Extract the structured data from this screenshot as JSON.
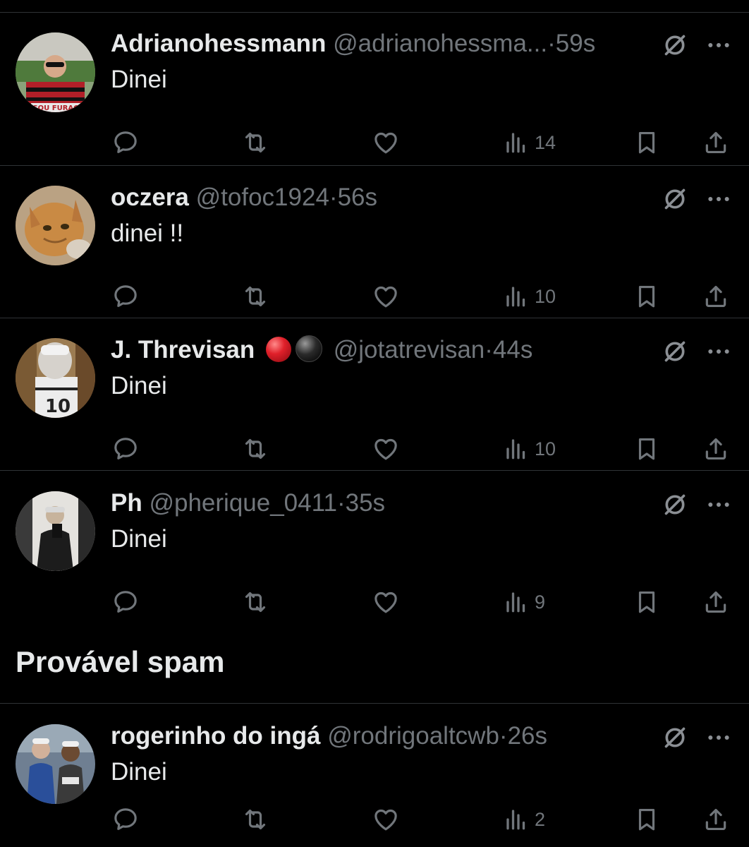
{
  "tweets": [
    {
      "display_name": "Adrianohessmann",
      "handle": "@adrianohessma...",
      "separator": "·",
      "time": "59s",
      "text": "Dinei",
      "views": "14",
      "avatar_caption": "SOU FURAC"
    },
    {
      "display_name": "oczera",
      "handle": "@tofoc1924",
      "separator": "·",
      "time": "56s",
      "text": "dinei !!",
      "views": "10"
    },
    {
      "display_name": "J. Threvisan",
      "handle": "@jotatrevisan",
      "separator": "·",
      "time": "44s",
      "text": "Dinei",
      "views": "10",
      "emojis": [
        "red-circle",
        "black-circle"
      ]
    },
    {
      "display_name": "Ph",
      "handle": "@pherique_0411",
      "separator": "·",
      "time": "35s",
      "text": "Dinei",
      "views": "9"
    }
  ],
  "spam_section": {
    "title": "Provável spam",
    "tweets": [
      {
        "display_name": "rogerinho do ingá",
        "handle": "@rodrigoaltcwb",
        "separator": "·",
        "time": "26s",
        "text": "Dinei",
        "views": "2"
      }
    ]
  },
  "colors": {
    "background": "#000000",
    "text_primary": "#e7e9ea",
    "text_secondary": "#71767b",
    "divider": "#2f3336"
  }
}
